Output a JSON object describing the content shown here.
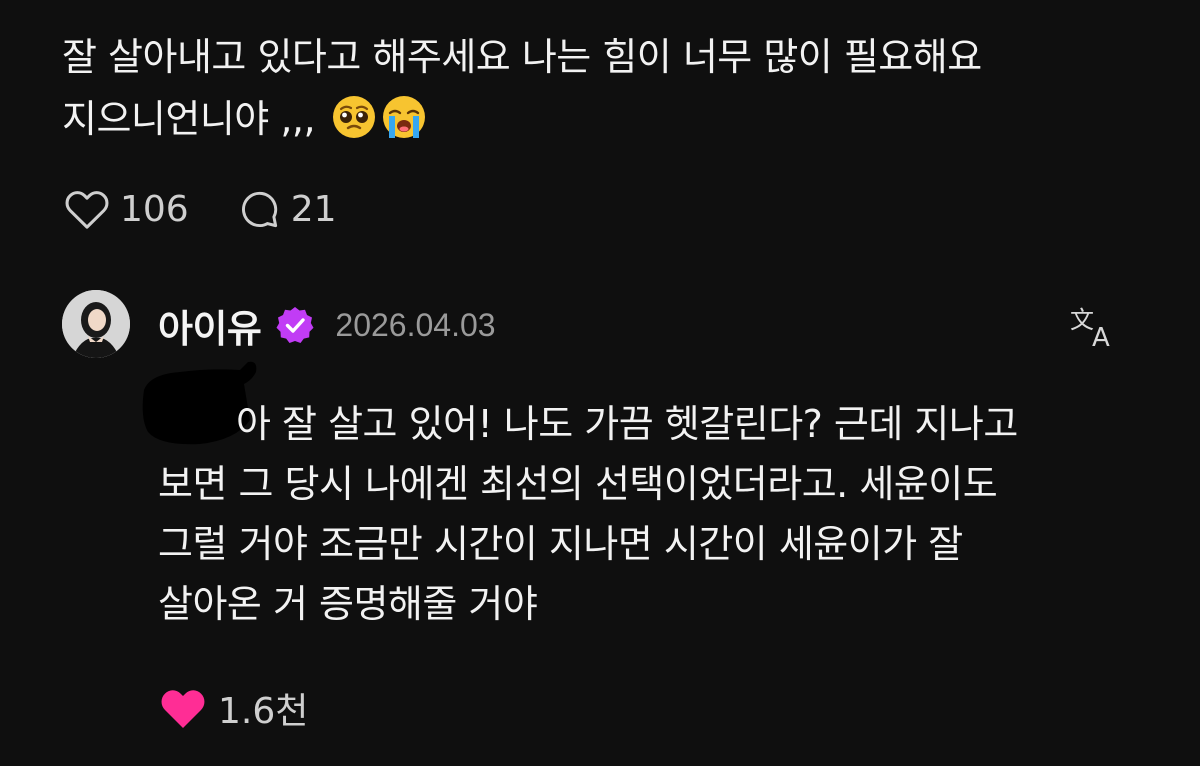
{
  "post": {
    "text_line1": "잘 살아내고 있다고 해주세요 나는 힘이 너무 많이 필요해요",
    "text_line2": "지으니언니야 ,,,",
    "emojis": [
      "pleading-face",
      "loudly-crying-face"
    ],
    "like_count": "106",
    "comment_count": "21"
  },
  "reply": {
    "username": "아이유",
    "verified": true,
    "date": "2026.04.03",
    "body_lines": [
      "아 잘 살고 있어! 나도 가끔 헷갈린다? 근데 지나고",
      "보면 그 당시 나에겐 최선의 선택이었더라고. 세윤이도",
      "그럴 거야  조금만 시간이 지나면 시간이 세윤이가 잘",
      "살아온 거 증명해줄 거야"
    ],
    "like_count": "1.6천",
    "liked": true
  },
  "colors": {
    "background": "#0f0f0f",
    "text": "#f2f2f2",
    "muted": "#9a9a9a",
    "liked_heart": "#ff2d95",
    "verified_badge": "#c13cf5"
  },
  "icons": [
    "heart-icon",
    "comment-icon",
    "verified-badge-icon",
    "translate-icon",
    "heart-filled-icon"
  ]
}
